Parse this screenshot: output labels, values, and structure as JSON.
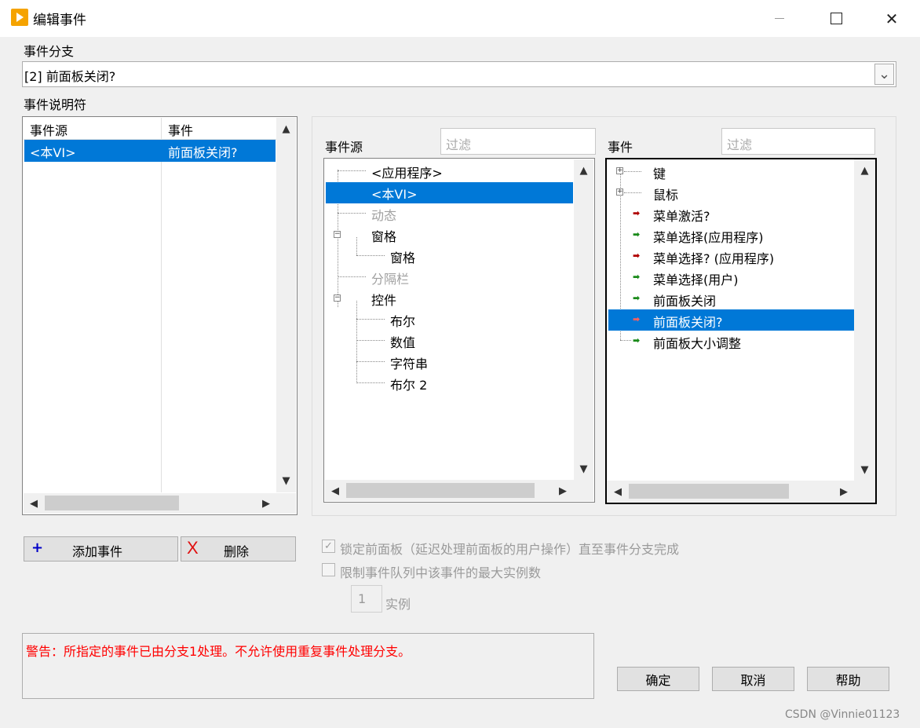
{
  "window": {
    "title": "编辑事件",
    "min_icon": "minimize-icon",
    "max_icon": "maximize-icon",
    "close_label": "✕"
  },
  "branch": {
    "label": "事件分支",
    "value": "[2] 前面板关闭?"
  },
  "descriptor": {
    "label": "事件说明符",
    "col_source": "事件源",
    "col_event": "事件",
    "rows": [
      {
        "source": "<本VI>",
        "event": "前面板关闭?"
      }
    ]
  },
  "source_panel": {
    "label": "事件源",
    "filter_placeholder": "过滤",
    "items": [
      {
        "text": "<应用程序>",
        "disabled": false
      },
      {
        "text": "<本VI>",
        "selected": true
      },
      {
        "text": "动态",
        "disabled": true
      },
      {
        "text": "窗格"
      },
      {
        "text": "窗格"
      },
      {
        "text": "分隔栏",
        "disabled": true
      },
      {
        "text": "控件"
      },
      {
        "text": "布尔"
      },
      {
        "text": "数值"
      },
      {
        "text": "字符串"
      },
      {
        "text": "布尔 2"
      }
    ]
  },
  "event_panel": {
    "label": "事件",
    "filter_placeholder": "过滤",
    "items": [
      {
        "text": "键"
      },
      {
        "text": "鼠标"
      },
      {
        "text": "菜单激活?",
        "arrow": "red"
      },
      {
        "text": "菜单选择(应用程序)",
        "arrow": "green"
      },
      {
        "text": "菜单选择?   (应用程序)",
        "arrow": "red"
      },
      {
        "text": "菜单选择(用户)",
        "arrow": "green"
      },
      {
        "text": "前面板关闭",
        "arrow": "green"
      },
      {
        "text": "前面板关闭?",
        "arrow": "red",
        "selected": true
      },
      {
        "text": "前面板大小调整",
        "arrow": "green"
      }
    ]
  },
  "buttons": {
    "add_icon": "+",
    "add": "添加事件",
    "delete_icon": "X",
    "delete": "删除",
    "ok": "确定",
    "cancel": "取消",
    "help": "帮助"
  },
  "options": {
    "lock_check": "✓",
    "lock_label": "锁定前面板（延迟处理前面板的用户操作）直至事件分支完成",
    "limit_label": "限制事件队列中该事件的最大实例数",
    "instances_value": "1",
    "instances_label": "实例"
  },
  "warning": "警告：所指定的事件已由分支1处理。不允许使用重复事件处理分支。",
  "watermark": "CSDN @Vinnie01123",
  "scroll": {
    "up": "▲",
    "down": "▼",
    "left": "◀",
    "right": "▶",
    "dropdown": "⌄"
  },
  "colors": {
    "accent": "#0078d7",
    "warning": "#ff0000",
    "arrow_red": "#b00000",
    "arrow_green": "#1a8a1a"
  }
}
